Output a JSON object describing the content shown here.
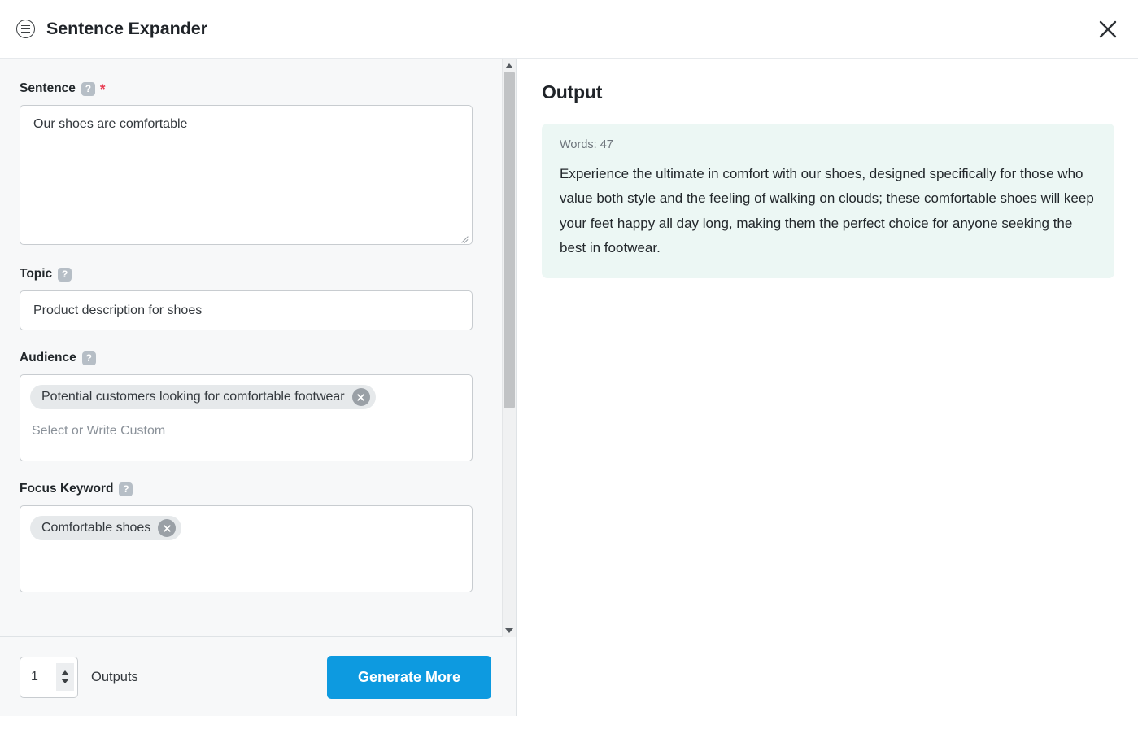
{
  "header": {
    "title": "Sentence Expander",
    "menu_icon": "circle-list-icon",
    "close_icon": "close-icon"
  },
  "form": {
    "sentence": {
      "label": "Sentence",
      "help_icon": "question-mark-icon",
      "required_marker": "*",
      "value": "Our shoes are comfortable"
    },
    "topic": {
      "label": "Topic",
      "help_icon": "question-mark-icon",
      "value": "Product description for shoes"
    },
    "audience": {
      "label": "Audience",
      "help_icon": "question-mark-icon",
      "tags": [
        "Potential customers looking for comfortable footwear"
      ],
      "placeholder": "Select or Write Custom"
    },
    "focus_keyword": {
      "label": "Focus Keyword",
      "help_icon": "question-mark-icon",
      "tags": [
        "Comfortable shoes"
      ]
    }
  },
  "footer": {
    "outputs_count": "1",
    "outputs_label": "Outputs",
    "generate_label": "Generate More"
  },
  "output": {
    "title": "Output",
    "words_label": "Words: 47",
    "text": "Experience the ultimate in comfort with our shoes, designed specifically for those who value both style and the feeling of walking on clouds; these comfortable shoes will keep your feet happy all day long, making them the perfect choice for anyone seeking the best in footwear."
  },
  "colors": {
    "accent": "#0d9ae0",
    "required": "#e8384f",
    "output_card_bg": "#ecf7f4",
    "panel_bg": "#f7f8f9"
  }
}
